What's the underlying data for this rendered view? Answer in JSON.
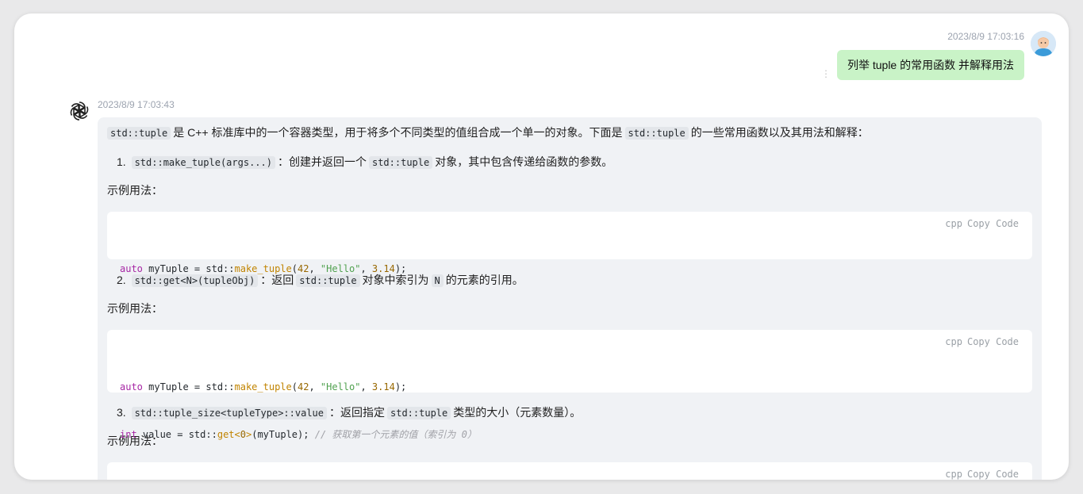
{
  "user_message": {
    "timestamp": "2023/8/9 17:03:16",
    "text": "列举 tuple 的常用函数 并解释用法",
    "more_icon": "vertical-ellipsis"
  },
  "assistant_message": {
    "timestamp": "2023/8/9 17:03:43",
    "intro": {
      "code1": "std::tuple",
      "text1": "是 C++ 标准库中的一个容器类型，用于将多个不同类型的值组合成一个单一的对象。下面是",
      "code2": "std::tuple",
      "text2": "的一些常用函数以及其用法和解释："
    },
    "items": [
      {
        "number": "1.",
        "code1": "std::make_tuple(args...)",
        "text1": "：创建并返回一个",
        "code2": "std::tuple",
        "text2": "对象，其中包含传递给函数的参数。",
        "example_label": "示例用法：",
        "code_block": {
          "lang": "cpp",
          "copy": "Copy Code",
          "line1": {
            "kw": "auto",
            "a": " myTuple = std::",
            "fn": "make_tuple",
            "b": "(",
            "n1": "42",
            "c": ", ",
            "s": "\"Hello\"",
            "d": ", ",
            "n2": "3.14",
            "e": ");"
          }
        }
      },
      {
        "number": "2.",
        "code1": "std::get<N>(tupleObj)",
        "text1": "：返回",
        "code2": "std::tuple",
        "text2": "对象中索引为",
        "code3": "N",
        "text3": "的元素的引用。",
        "example_label": "示例用法：",
        "code_block": {
          "lang": "cpp",
          "copy": "Copy Code",
          "line1": {
            "kw": "auto",
            "a": " myTuple = std::",
            "fn": "make_tuple",
            "b": "(",
            "n1": "42",
            "c": ", ",
            "s": "\"Hello\"",
            "d": ", ",
            "n2": "3.14",
            "e": ");"
          },
          "line2": {
            "kw": "int",
            "a": " value = std::",
            "fn": "get",
            "lt": "<",
            "n": "0",
            "gt": ">",
            "b": "(myTuple); ",
            "cmt": "// 获取第一个元素的值（索引为 0）"
          }
        }
      },
      {
        "number": "3.",
        "code1": "std::tuple_size<tupleType>::value",
        "text1": "：返回指定",
        "code2": "std::tuple",
        "text2": "类型的大小（元素数量）。",
        "example_label": "示例用法：",
        "code_block": {
          "lang": "cpp",
          "copy": "Copy Code"
        }
      }
    ]
  },
  "colors": {
    "user_bubble": "#c9f3c7",
    "answer_bg": "#f0f2f5",
    "code_bg": "#ffffff",
    "keyword": "#a626a4",
    "function": "#c18401",
    "string": "#50a14f",
    "number": "#986801",
    "comment": "#a0a1a7"
  }
}
